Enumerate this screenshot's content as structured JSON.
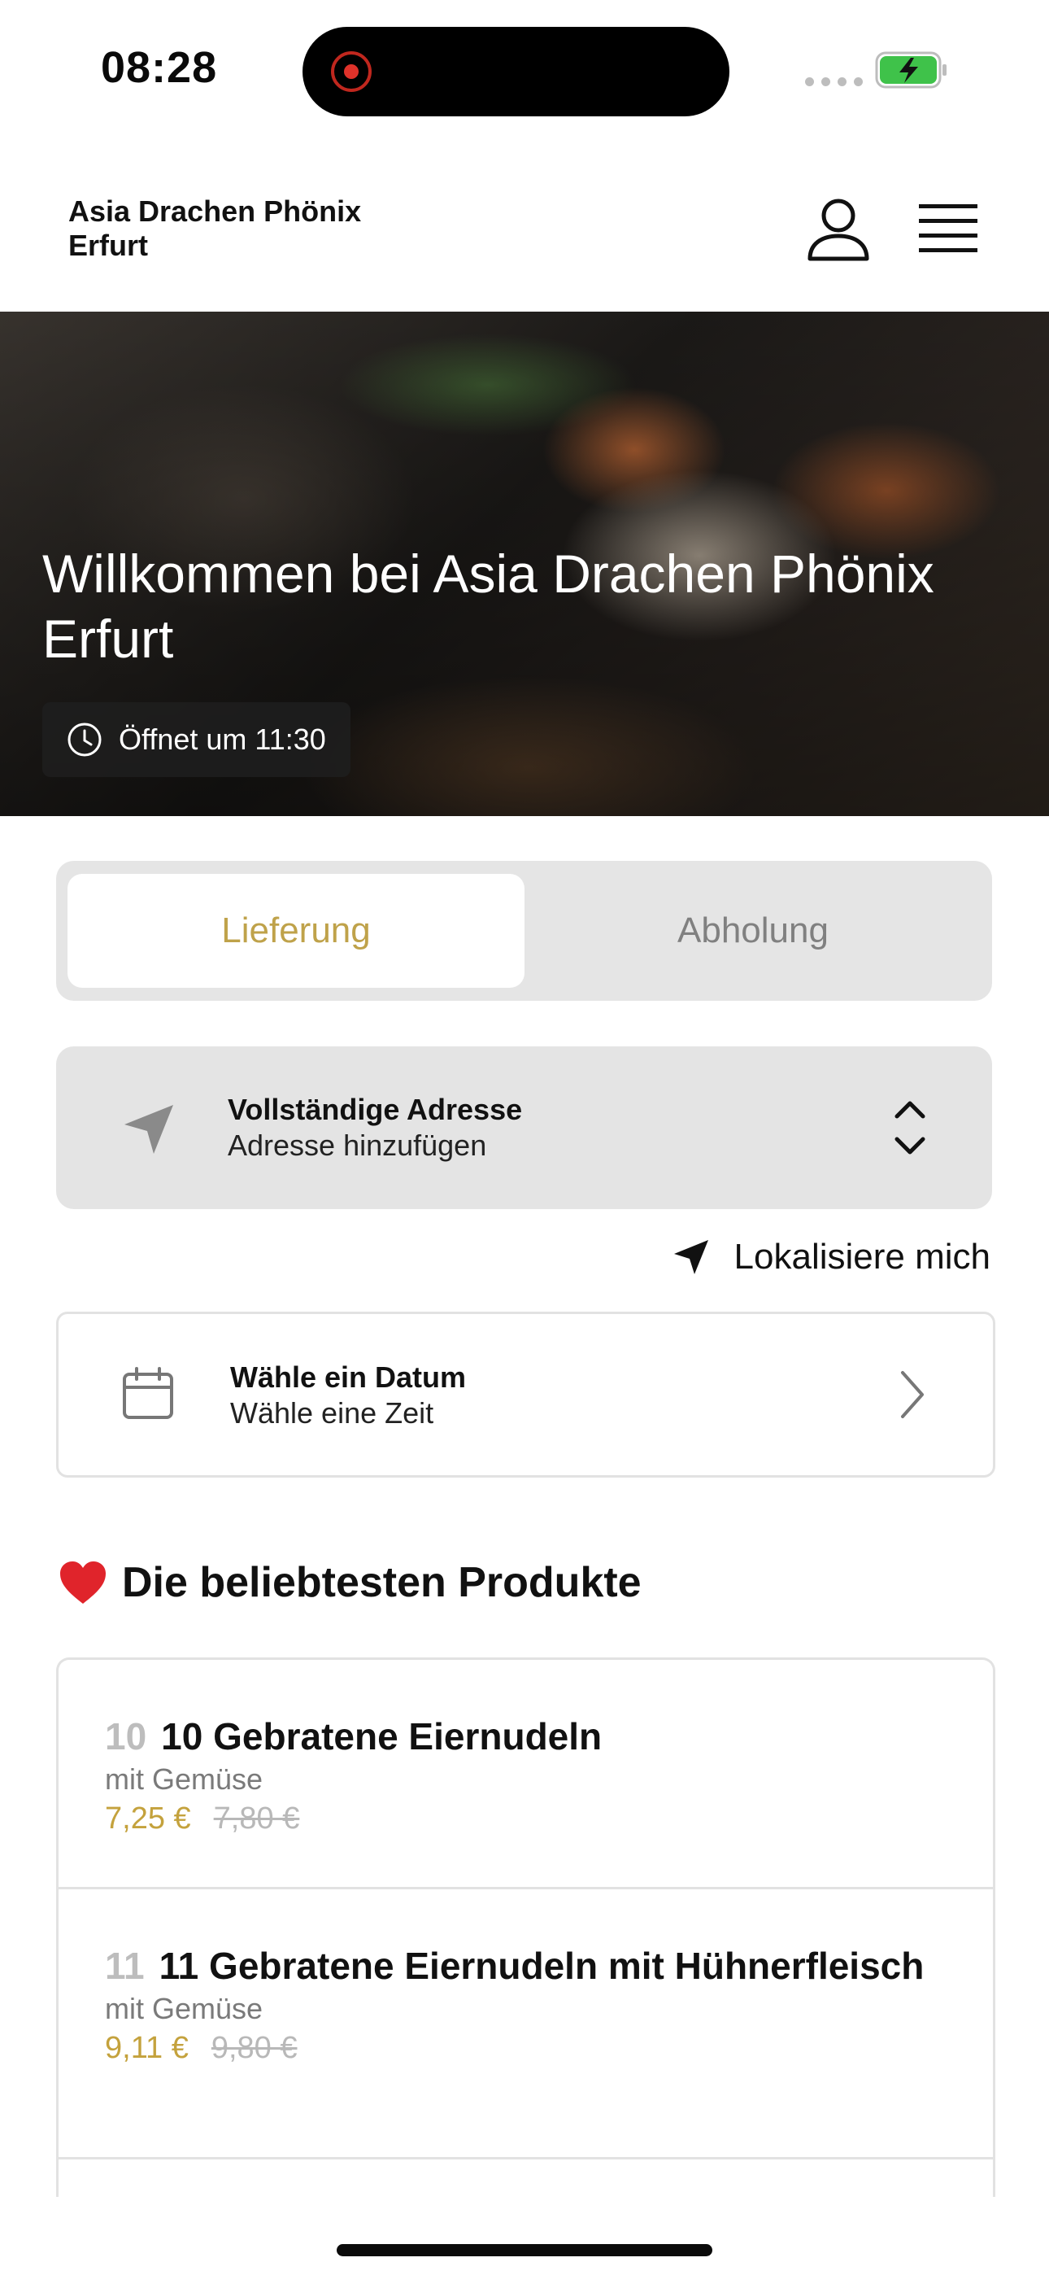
{
  "status_bar": {
    "time": "08:28"
  },
  "header": {
    "brand_line1": "Asia Drachen Phönix",
    "brand_line2": "Erfurt"
  },
  "hero": {
    "title": "Willkommen bei Asia Drachen Phönix Erfurt",
    "opening": "Öffnet um 11:30"
  },
  "order_mode": {
    "delivery": "Lieferung",
    "pickup": "Abholung",
    "selected": "Lieferung"
  },
  "address": {
    "title": "Vollständige Adresse",
    "subtitle": "Adresse hinzufügen"
  },
  "locate": {
    "label": "Lokalisiere mich"
  },
  "schedule": {
    "title": "Wähle ein Datum",
    "subtitle": "Wähle eine Zeit"
  },
  "popular": {
    "title": "Die beliebtesten Produkte",
    "products": [
      {
        "number": "10",
        "name": "10 Gebratene Eiernudeln",
        "subtitle": "mit Gemüse",
        "price": "7,25 €",
        "old_price": "7,80 €"
      },
      {
        "number": "11",
        "name": "11 Gebratene Eiernudeln mit Hühnerfleisch",
        "subtitle": "mit Gemüse",
        "price": "9,11 €",
        "old_price": "9,80 €"
      }
    ]
  },
  "colors": {
    "accent": "#bfa24a",
    "price": "#c4a23d"
  },
  "icons": [
    "record-icon",
    "battery-icon",
    "user-icon",
    "menu-icon",
    "clock-icon",
    "navigation-arrow-icon",
    "chevron-up-down-icon",
    "location-arrow-icon",
    "calendar-icon",
    "chevron-right-icon",
    "heart-icon"
  ]
}
